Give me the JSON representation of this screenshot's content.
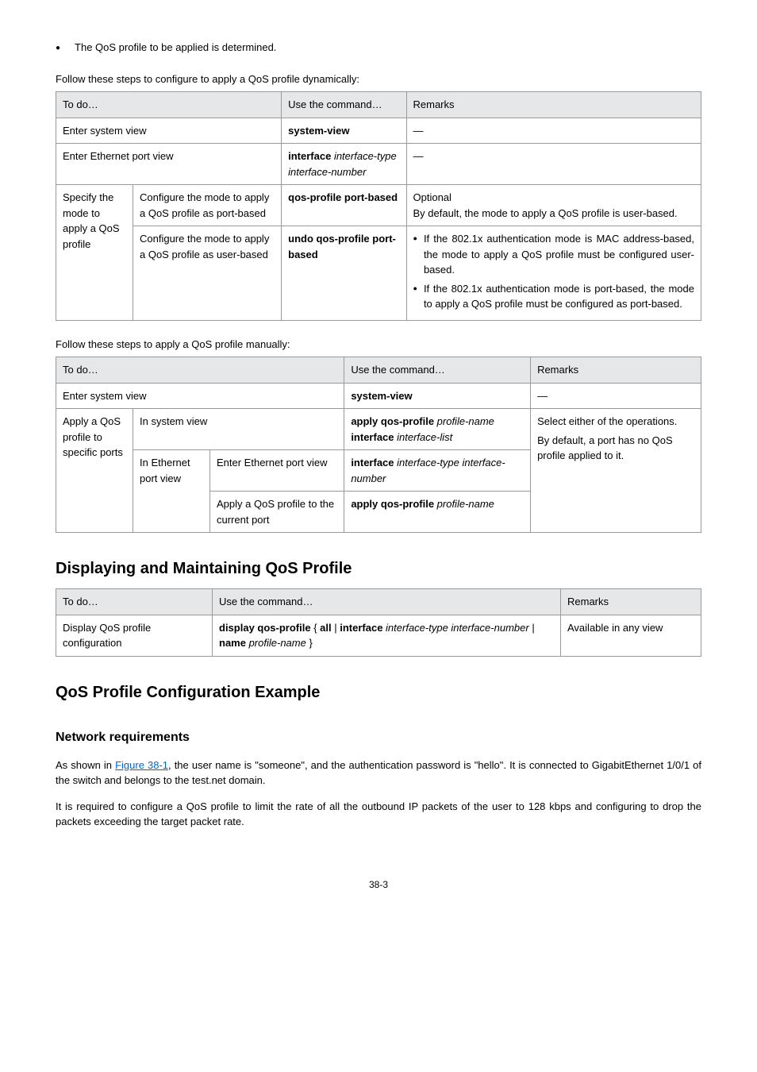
{
  "top_bullet": "The QoS profile to be applied is determined.",
  "lead1": "Follow these steps to configure to apply a QoS profile dynamically:",
  "table1": {
    "headers": [
      "To do…",
      "Use the command…",
      "Remarks"
    ],
    "r1c1": "Enter system view",
    "r1c2": "system-view",
    "r1c3": "—",
    "r2c1": "Enter Ethernet port view",
    "r2c2_a": "interface ",
    "r2c2_b": "interface-type interface-number",
    "r2c3": "—",
    "r3a": "Specify the mode to apply a QoS profile",
    "r3b1": "Configure the mode to apply a QoS profile as port-based",
    "r3b1_cmd": "qos-profile port-based",
    "r3b1_rem1": "Optional",
    "r3b1_rem2": "By default, the mode to apply a QoS profile is user-based.",
    "r3b2": "Configure the mode to apply a QoS profile as user-based",
    "r3b2_cmd_a": "undo qos-profile port-based",
    "r3b2_rem_bul1": "If the 802.1x authentication mode is MAC address-based, the mode to apply a QoS profile must be configured user-based.",
    "r3b2_rem_bul2": "If the 802.1x authentication mode is port-based, the mode to apply a QoS profile must be configured as port-based."
  },
  "lead2": "Follow these steps to apply a QoS profile manually:",
  "table2": {
    "headers": [
      "To do…",
      "Use the command…",
      "Remarks"
    ],
    "r1c1": "Enter system view",
    "r1c2": "system-view",
    "r1c3": "—",
    "groupA": "Apply a QoS profile to specific ports",
    "a1": "In system view",
    "a1_cmd_a": "apply qos-profile ",
    "a1_cmd_b": "profile-name",
    "a1_cmd_c": " interface ",
    "a1_cmd_d": "interface-list",
    "groupB": "In Ethernet port view",
    "b1": "Enter Ethernet port view",
    "b1_cmd_a": "interface ",
    "b1_cmd_b": "interface-type interface-number",
    "b2": "Apply a QoS profile to the current port",
    "b2_cmd_a": "apply qos-profile ",
    "b2_cmd_b": "profile-name",
    "remA": "Select either of the operations.",
    "remB": "By default, a port has no QoS profile applied to it."
  },
  "h2": "Displaying and Maintaining QoS Profile",
  "table3": {
    "headers": [
      "To do…",
      "Use the command…",
      "Remarks"
    ],
    "r1c1": "Display QoS profile configuration",
    "r1c2_a": "display qos-profile",
    "r1c2_b": " { ",
    "r1c2_c": "all",
    "r1c2_d": " | ",
    "r1c2_e": "interface ",
    "r1c2_f": "interface-type interface-number",
    "r1c2_g": " | ",
    "r1c2_h": "name ",
    "r1c2_i": "profile-name",
    "r1c2_j": " }",
    "r1c3": "Available in any view"
  },
  "h3": "QoS Profile Configuration Example",
  "h4": "Network requirements",
  "para1_a": "As shown in ",
  "para1_link": "Figure 38-1",
  "para1_b": ", the user name is \"someone\", and the authentication password is \"hello\". It is connected to GigabitEthernet 1/0/1 of the switch and belongs to the test.net domain.",
  "para2": "It is required to configure a QoS profile to limit the rate of all the outbound IP packets of the user to 128 kbps and configuring to drop the packets exceeding the target packet rate.",
  "page": "38-3"
}
